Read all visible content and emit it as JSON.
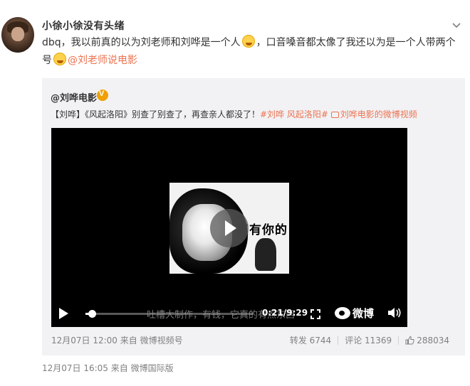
{
  "post": {
    "username": "小徐小徐没有头绪",
    "text_line1": "dbq，我以前真的以为刘老师和刘哗是一个人",
    "text_line1_after": "，口音嗓音都太像了我还以为是一个人带两个",
    "text_line2": "号",
    "mention": "@刘老师说电影",
    "emoji_name": "laugh-cry-emoji",
    "meta": "12月07日 16:05  来自 微博国际版"
  },
  "repost": {
    "author": "@刘哗电影",
    "text_prefix": "【刘哗】《风起洛阳》别查了别查了，再查亲人都没了！",
    "hashtag": "#刘哗 风起洛阳#",
    "video_link": "刘哗电影的微博视频",
    "meta": "12月07日 12:00  来自 微博视频号",
    "reposts": "转发 6744",
    "comments": "评论 11369",
    "likes": "288034"
  },
  "video": {
    "caption": "真有你的",
    "subtitle": "吐槽大制作，有钱，它真的有点东西",
    "time": "0:21/9:29",
    "progress": 0.037,
    "brand": "微博"
  },
  "icons": {
    "menu": "chevron-down-icon",
    "verified": "verified-badge-icon",
    "play": "play-icon",
    "fullscreen": "fullscreen-icon",
    "volume": "volume-icon",
    "like": "thumbs-up-icon"
  },
  "colors": {
    "link": "#eb7350",
    "repost_bg": "#f2f2f5",
    "meta_text": "#808080"
  }
}
